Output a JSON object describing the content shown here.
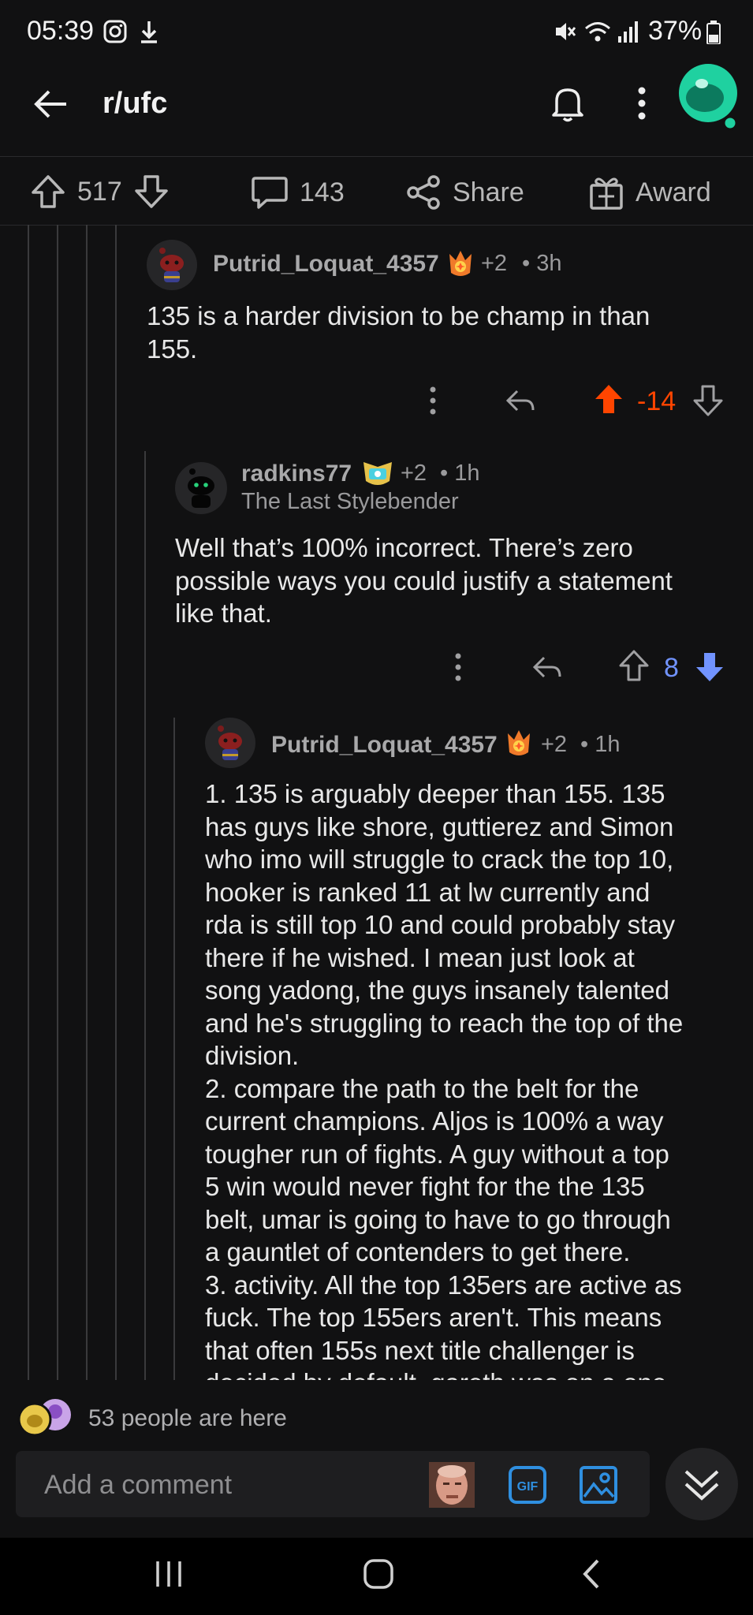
{
  "status": {
    "time": "05:39",
    "battery": "37%"
  },
  "header": {
    "title": "r/ufc"
  },
  "post_actions": {
    "upvotes": "517",
    "comments": "143",
    "share": "Share",
    "award": "Award"
  },
  "comments": [
    {
      "user": "Putrid_Loquat_4357",
      "karma": "+2",
      "age": "• 3h",
      "lines": [
        "135 is a harder division to be champ in than",
        "155."
      ],
      "score": "-14"
    },
    {
      "user": "radkins77",
      "karma": "+2",
      "age": "• 1h",
      "flair": "The Last Stylebender",
      "lines": [
        "Well that’s 100% incorrect. There’s zero",
        "possible ways you could justify a statement",
        "like that."
      ],
      "score": "8"
    },
    {
      "user": "Putrid_Loquat_4357",
      "karma": "+2",
      "age": "• 1h",
      "lines": [
        "1. 135 is arguably deeper than 155. 135",
        "has guys like shore, guttierez and Simon",
        "who imo will struggle to crack the top 10,",
        "hooker is ranked 11 at lw currently and",
        "rda is still top 10 and could probably stay",
        "there if he wished. I mean just look at",
        "song yadong, the guys insanely talented",
        "and he's struggling to reach the top of the",
        "division.",
        "2. compare the path to the belt for the",
        "current champions. Aljos is 100% a way",
        "tougher run of fights. A guy without a top",
        "5 win would never fight for the the 135",
        "belt, umar is going to have to go through",
        "a gauntlet of contenders to get there.",
        "3. activity. All the top 135ers are active as",
        "fuck. The top 155ers aren't. This means",
        "that often 155s next title challenger is",
        "decided by default, gareth was on a one"
      ]
    }
  ],
  "presence": {
    "text": "53 people are here"
  },
  "composer": {
    "placeholder": "Add a comment",
    "gif": "GIF"
  },
  "colors": {
    "downvote_active": "#ff4500",
    "upvote_blue": "#7193ff"
  }
}
